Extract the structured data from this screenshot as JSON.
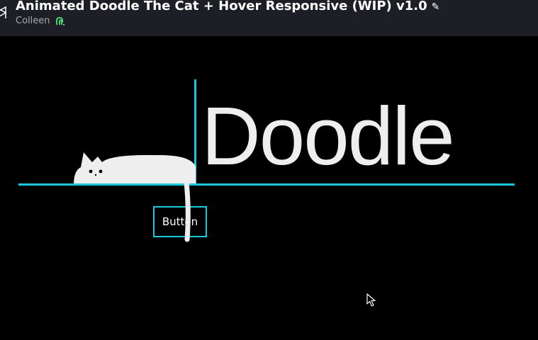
{
  "header": {
    "title": "Animated Doodle The Cat + Hover Responsive (WIP) v1.0",
    "author": "Colleen",
    "icons": {
      "logo": "codepen-logo-icon",
      "edit": "pencil-icon",
      "pro": "pro-badge-icon"
    }
  },
  "stage": {
    "heading": "Doodle",
    "button_label": "Button"
  },
  "colors": {
    "header_bg": "#1e1f26",
    "accent": "#19c8da",
    "cat": "#eeeeee",
    "text": "#ffffff",
    "author": "#a8a9ad",
    "pro_badge": "#47cf73"
  }
}
